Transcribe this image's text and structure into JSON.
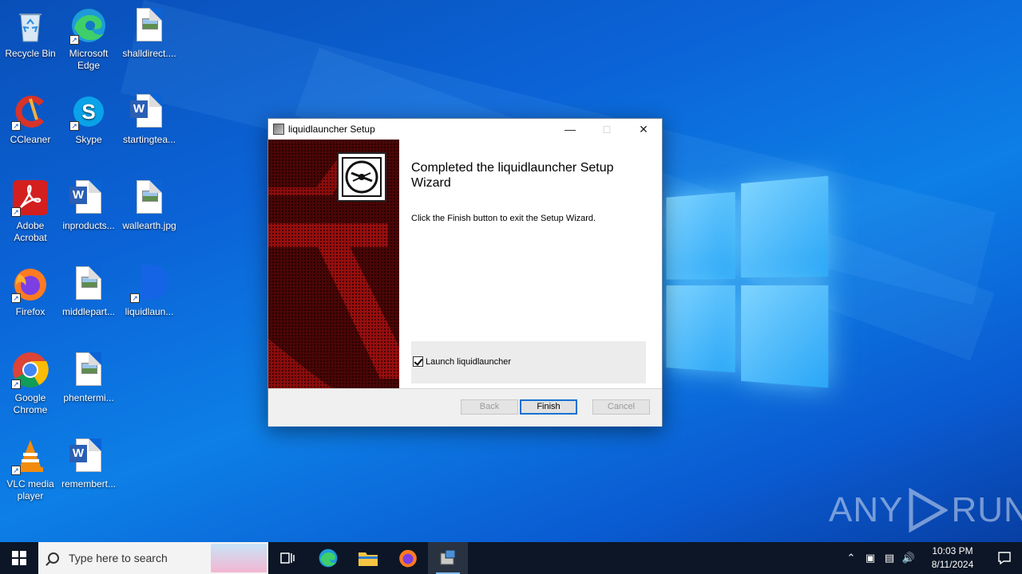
{
  "desktop": {
    "icons": [
      {
        "label": "Recycle Bin",
        "icon": "recycle-bin-icon"
      },
      {
        "label": "Microsoft Edge",
        "icon": "edge-icon"
      },
      {
        "label": "shalldirect....",
        "icon": "image-file-icon"
      },
      {
        "label": "CCleaner",
        "icon": "ccleaner-icon"
      },
      {
        "label": "Skype",
        "icon": "skype-icon"
      },
      {
        "label": "startingtea...",
        "icon": "word-doc-icon"
      },
      {
        "label": "Adobe Acrobat",
        "icon": "acrobat-icon"
      },
      {
        "label": "inproducts...",
        "icon": "word-doc-icon"
      },
      {
        "label": "wallearth.jpg",
        "icon": "image-file-icon"
      },
      {
        "label": "Firefox",
        "icon": "firefox-icon"
      },
      {
        "label": "middlepart...",
        "icon": "image-file-icon"
      },
      {
        "label": "liquidlaun...",
        "icon": "liquidlauncher-icon"
      },
      {
        "label": "Google Chrome",
        "icon": "chrome-icon"
      },
      {
        "label": "phentermi...",
        "icon": "image-file-icon"
      },
      {
        "label": "VLC media player",
        "icon": "vlc-icon"
      },
      {
        "label": "remembert...",
        "icon": "word-doc-icon"
      }
    ]
  },
  "dialog": {
    "title": "liquidlauncher Setup",
    "heading": "Completed the liquidlauncher Setup Wizard",
    "body": "Click the Finish button to exit the Setup Wizard.",
    "launch_label": "Launch liquidlauncher",
    "launch_checked": true,
    "buttons": {
      "back": "Back",
      "finish": "Finish",
      "cancel": "Cancel"
    }
  },
  "watermark": {
    "left": "ANY",
    "right": "RUN"
  },
  "taskbar": {
    "search_placeholder": "Type here to search",
    "time": "10:03 PM",
    "date": "8/11/2024"
  },
  "colors": {
    "banner": "#4a0606",
    "accent": "#1a6fd1",
    "taskbar": "#0c1626"
  }
}
